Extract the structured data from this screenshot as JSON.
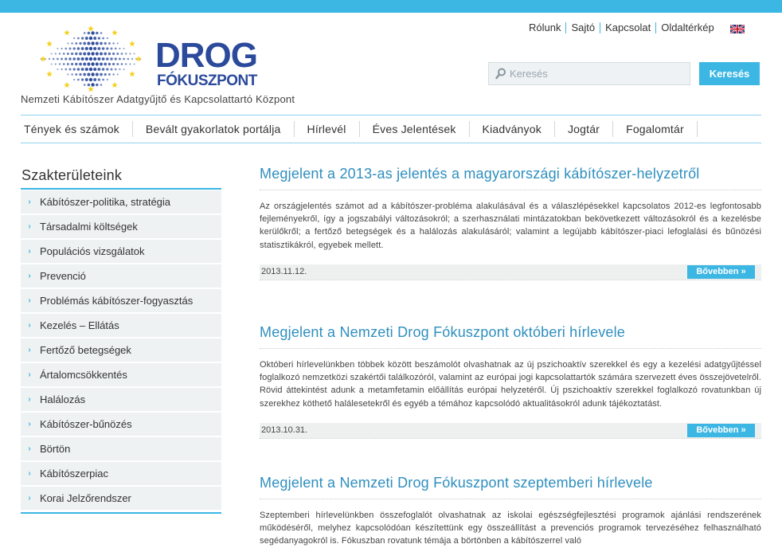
{
  "site": {
    "logo_line1": "DROG",
    "logo_line2": "FÓKUSZPONT",
    "tagline": "Nemzeti Kábítószer Adatgyűjtő és Kapcsolattartó Központ"
  },
  "toplinks": [
    "Rólunk",
    "Sajtó",
    "Kapcsolat",
    "Oldaltérkép"
  ],
  "search": {
    "placeholder": "Keresés",
    "button_label": "Keresés"
  },
  "nav": [
    "Tények és számok",
    "Bevált gyakorlatok portálja",
    "Hírlevél",
    "Éves Jelentések",
    "Kiadványok",
    "Jogtár",
    "Fogalomtár"
  ],
  "sidebar": {
    "title": "Szakterületeink",
    "items": [
      "Kábítószer-politika, stratégia",
      "Társadalmi költségek",
      "Populációs vizsgálatok",
      "Prevenció",
      "Problémás kábítószer-fogyasztás",
      "Kezelés – Ellátás",
      "Fertőző betegségek",
      "Ártalomcsökkentés",
      "Halálozás",
      "Kábítószer-bűnözés",
      "Börtön",
      "Kábítószerpiac",
      "Korai Jelzőrendszer"
    ]
  },
  "articles": [
    {
      "title": "Megjelent a 2013-as jelentés a magyarországi kábítószer-helyzetről",
      "body": "Az országjelentés számot ad a kábítószer-probléma alakulásával és a válaszlépésekkel kapcsolatos 2012-es legfontosabb fejleményekről, így a jogszabályi változásokról; a szerhasználati mintázatokban bekövetkezett változásokról és a kezelésbe kerülőkről; a fertőző betegségek és a halálozás alakulásáról; valamint a legújabb kábítószer-piaci lefoglalási és bűnözési statisztikákról, egyebek mellett.",
      "date": "2013.11.12.",
      "more": "Bővebben »"
    },
    {
      "title": "Megjelent a Nemzeti Drog Fókuszpont októberi hírlevele",
      "body": "Októberi hírlevelünkben többek között beszámolót olvashatnak az új pszichoaktív szerekkel és egy a kezelési adatgyűjtéssel foglalkozó nemzetközi szakértői találkozóról, valamint az európai jogi kapcsolattartók számára szervezett éves összejövetelről. Rövid áttekintést adunk a metamfetamin előállítás európai helyzetéről. Új pszichoaktív szerekkel foglalkozó rovatunkban új szerekhez köthető halálesetekről és egyéb a témához kapcsolódó aktualitásokról adunk tájékoztatást.",
      "date": "2013.10.31.",
      "more": "Bővebben »"
    },
    {
      "title": "Megjelent a Nemzeti Drog Fókuszpont szeptemberi hírlevele",
      "body": "Szeptemberi hírlevelünkben összefoglalót olvashatnak az iskolai egészségfejlesztési programok ajánlási rendszerének működéséről, melyhez kapcsolódóan készítettünk egy összeállítást a prevenciós programok tervezéséhez felhasználható segédanyagokról is. Fókuszban rovatunk témája a börtönben a kábítószerrel való",
      "date": "",
      "more": ""
    }
  ],
  "colors": {
    "accent": "#3cb6e3",
    "logo_blue": "#2b4a9b",
    "title_blue": "#2f8fbf",
    "star_yellow": "#f4d01e"
  }
}
